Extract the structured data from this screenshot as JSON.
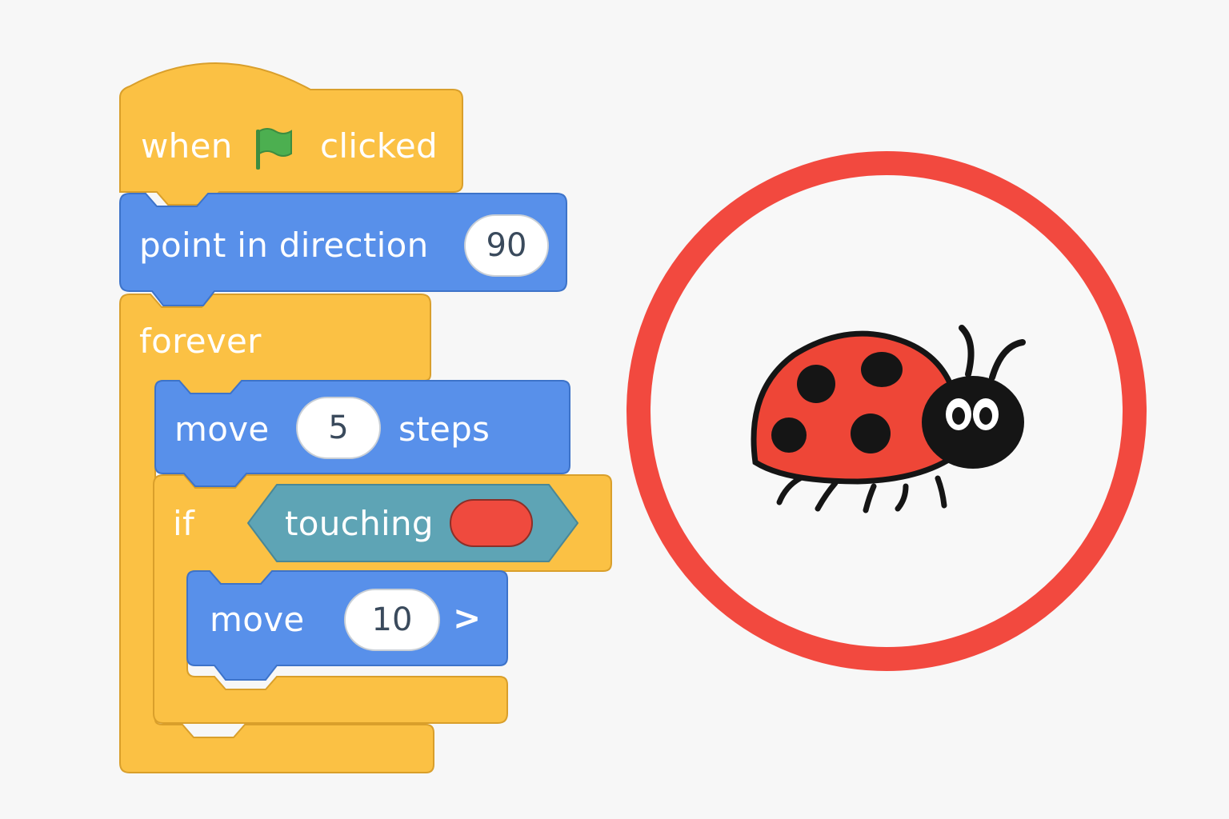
{
  "colors": {
    "events": "#fbc144",
    "motion": "#5890ea",
    "control": "#fbc144",
    "sensing": "#5ea4b5",
    "touch_color": "#ef4a3e",
    "stage_ring": "#f2493f",
    "ladybug_shell": "#ee4637",
    "ladybug_black": "#151515",
    "flag": "#4caf50"
  },
  "blocks": {
    "when_flag": {
      "label_when": "when",
      "flag_icon": "green-flag-icon",
      "label_clicked": "clicked"
    },
    "point_in_direction": {
      "label": "point in direction",
      "value": "90"
    },
    "forever": {
      "label": "forever"
    },
    "move_steps": {
      "label_move": "move",
      "value": "5",
      "label_steps": "steps"
    },
    "if_block": {
      "label": "if"
    },
    "touching": {
      "label": "touching",
      "color": "#ef4a3e"
    },
    "move_ten": {
      "label_move": "move",
      "value": "10",
      "arrow": ">"
    }
  },
  "stage": {
    "sprite_icon": "ladybug-icon"
  }
}
